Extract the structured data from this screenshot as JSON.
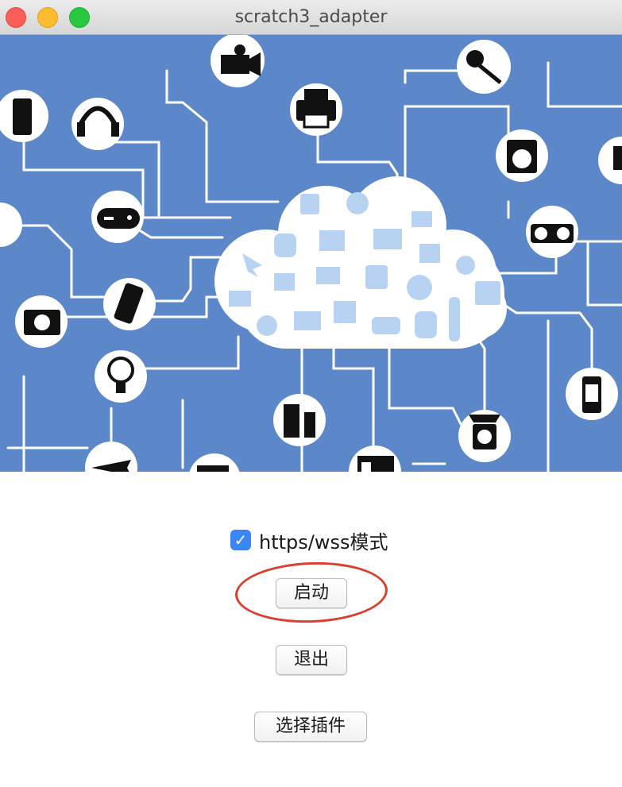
{
  "window": {
    "title": "scratch3_adapter",
    "controls": [
      "close",
      "minimize",
      "maximize"
    ]
  },
  "banner": {
    "description_icon": "iot-cloud-network-illustration",
    "background_color": "#5c88c9"
  },
  "options": {
    "https_wss_label": "https/wss模式",
    "https_wss_checked": true,
    "check_glyph": "✓"
  },
  "buttons": {
    "start_label": "启动",
    "quit_label": "退出",
    "select_plugin_label": "选择插件"
  },
  "annotation": {
    "color": "#d94030"
  }
}
